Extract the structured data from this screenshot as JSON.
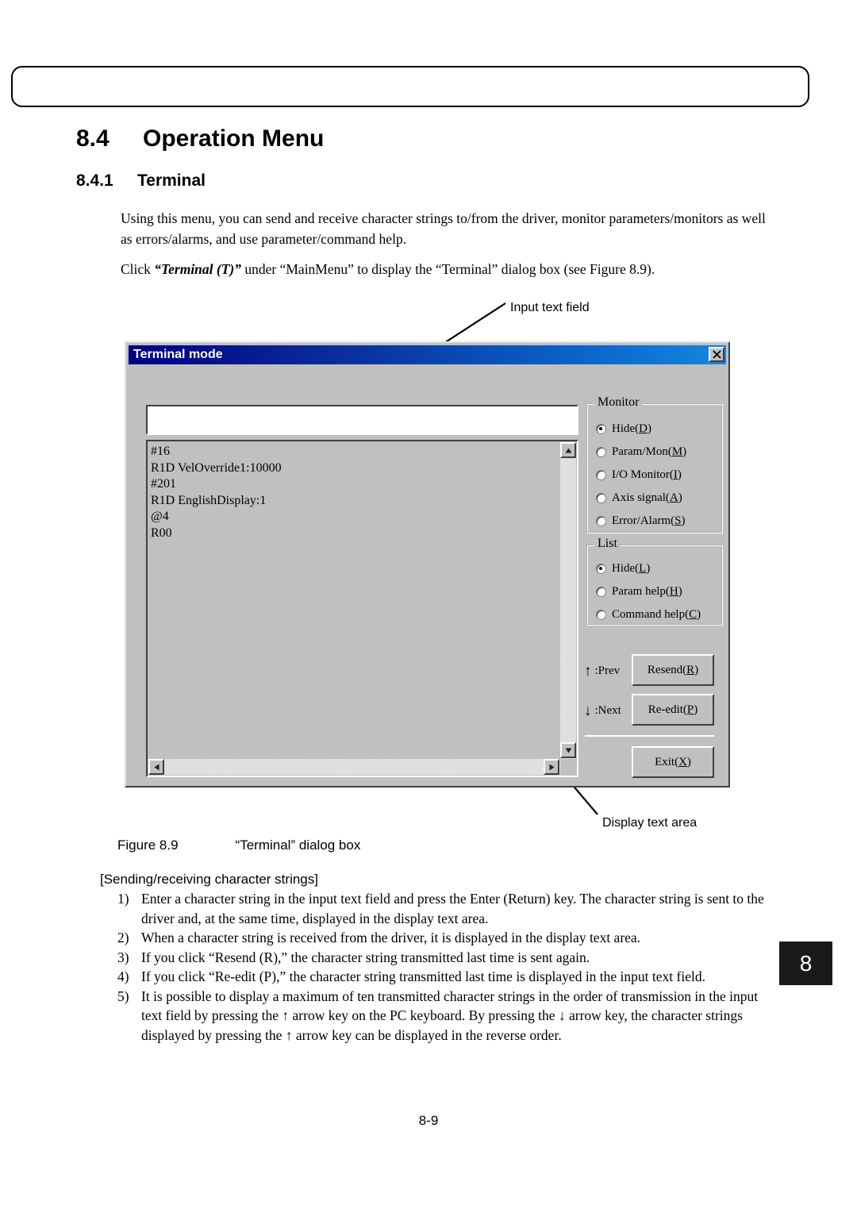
{
  "document": {
    "section_number": "8.4",
    "section_title": "Operation Menu",
    "subsection_number": "8.4.1",
    "subsection_title": "Terminal",
    "paragraph_1": "Using this menu, you can send and receive character strings to/from the driver, monitor parameters/monitors as well as errors/alarms, and use parameter/command help.",
    "paragraph_2_prefix": "Click ",
    "paragraph_2_emphasis": "“Terminal (T)”",
    "paragraph_2_suffix": " under “MainMenu” to display the “Terminal” dialog box (see Figure 8.9).",
    "figure_caption_label": "Figure 8.9",
    "figure_caption_text": "“Terminal” dialog box",
    "list_heading": "[Sending/receiving character strings]",
    "page_tab": "8",
    "page_number": "8-9"
  },
  "annotations": {
    "input_text_field": "Input text field",
    "display_text_area": "Display text area"
  },
  "dialog": {
    "title": "Terminal mode",
    "close_label": "✕",
    "input_field_value": "",
    "input_field_placeholder": "",
    "display_text": "#16\nR1D VelOverride1:10000\n#201\nR1D EnglishDisplay:1\n@4\nR00",
    "monitor_group": {
      "legend": "Monitor",
      "options": [
        {
          "label": "Hide(",
          "key": "D",
          "suffix": ")",
          "checked": true
        },
        {
          "label": "Param/Mon(",
          "key": "M",
          "suffix": ")",
          "checked": false
        },
        {
          "label": "I/O Monitor(",
          "key": "I",
          "suffix": ")",
          "checked": false
        },
        {
          "label": "Axis signal(",
          "key": "A",
          "suffix": ")",
          "checked": false
        },
        {
          "label": "Error/Alarm(",
          "key": "S",
          "suffix": ")",
          "checked": false
        }
      ]
    },
    "list_group": {
      "legend": "List",
      "options": [
        {
          "label": "Hide(",
          "key": "L",
          "suffix": ")",
          "checked": true
        },
        {
          "label": "Param help(",
          "key": "H",
          "suffix": ")",
          "checked": false
        },
        {
          "label": "Command help(",
          "key": "C",
          "suffix": ")",
          "checked": false
        }
      ]
    },
    "nav_hints": {
      "prev_arrow": "↑",
      "prev_label": ":Prev",
      "next_arrow": "↓",
      "next_label": ":Next"
    },
    "buttons": {
      "resend_prefix": "Resend(",
      "resend_key": "R",
      "resend_suffix": ")",
      "reedit_prefix": "Re-edit(",
      "reedit_key": "P",
      "reedit_suffix": ")",
      "exit_prefix": "Exit(",
      "exit_key": "X",
      "exit_suffix": ")"
    }
  },
  "instructions": [
    {
      "marker": "1)",
      "text": "Enter a character string in the input text field and press the Enter (Return) key. The character string is sent to the driver and, at the same time, displayed in the display text area."
    },
    {
      "marker": "2)",
      "text": "When a character string is received from the driver, it is displayed in the display text area."
    },
    {
      "marker": "3)",
      "text": "If you click “Resend (R),” the character string transmitted last time is sent again."
    },
    {
      "marker": "4)",
      "text": "If you click “Re-edit (P),” the character string transmitted last time is displayed in the input text field."
    },
    {
      "marker": "5)",
      "text": "It is possible to display a maximum of ten transmitted character strings in the order of transmission in the input text field by pressing the ↑ arrow key on the PC keyboard. By pressing the ↓ arrow key, the character strings displayed by pressing the ↑ arrow key can be displayed in the reverse order."
    }
  ],
  "colors": {
    "titlebar_start": "#000082",
    "titlebar_end": "#1387de",
    "dialog_face": "#c0c0c0",
    "tab_marker_bg": "#1a1a1a"
  }
}
